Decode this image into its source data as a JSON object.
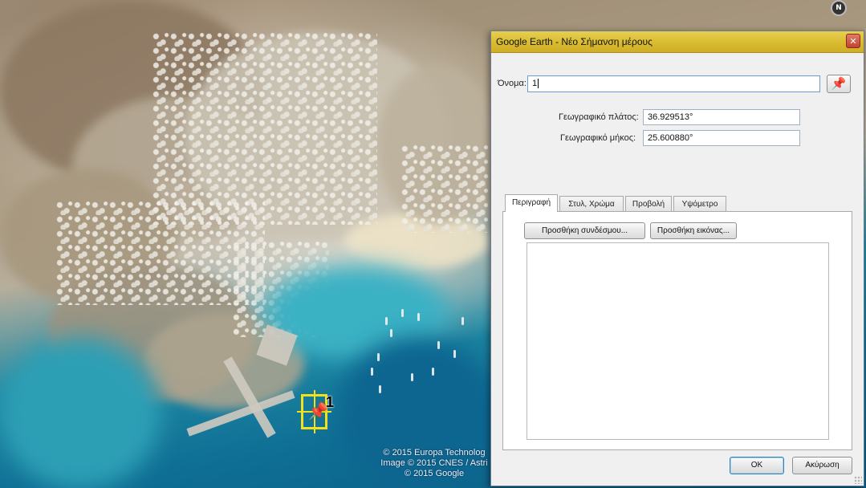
{
  "map": {
    "north_indicator": "N",
    "placemark_label": "1",
    "copyright_lines": [
      "© 2015 Europa Technolog",
      "Image © 2015 CNES / Astri",
      "© 2015 Google"
    ]
  },
  "dialog": {
    "title": "Google Earth - Νέο Σήμανση μέρους",
    "close_icon": "close-icon",
    "name": {
      "label": "Όνομα:",
      "value": "1"
    },
    "pin_icon": "pushpin-icon",
    "latitude": {
      "label": "Γεωγραφικό πλάτος:",
      "value": "36.929513°"
    },
    "longitude": {
      "label": "Γεωγραφικό μήκος:",
      "value": "25.600880°"
    },
    "tabs": [
      {
        "label": "Περιγραφή",
        "active": true
      },
      {
        "label": "Στυλ, Χρώμα",
        "active": false
      },
      {
        "label": "Προβολή",
        "active": false
      },
      {
        "label": "Υψόμετρο",
        "active": false
      }
    ],
    "add_link_label": "Προσθήκη συνδέσμου...",
    "add_image_label": "Προσθήκη εικόνας...",
    "description_value": "",
    "ok_label": "OK",
    "cancel_label": "Ακύρωση"
  },
  "colors": {
    "titlebar": "#d9bb2f",
    "placemark_highlight": "#f1e01a"
  }
}
